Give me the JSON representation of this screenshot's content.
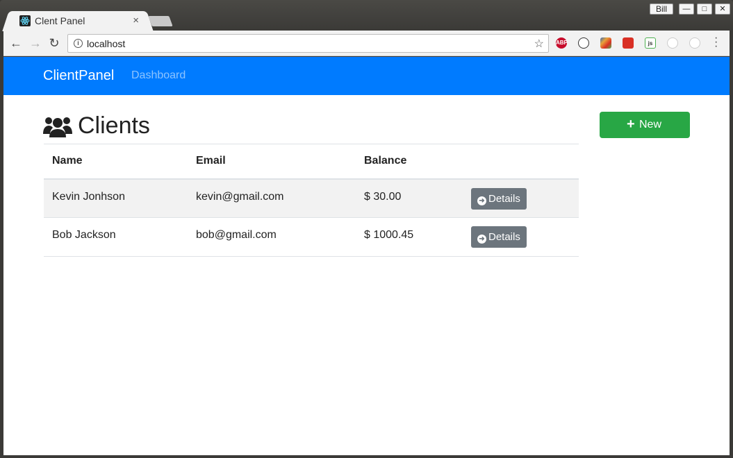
{
  "browser": {
    "tab_title": "Clent Panel",
    "tab_close": "×",
    "user_button": "Bill",
    "url": "localhost",
    "window_controls": [
      "minimize-icon",
      "maximize-icon",
      "close-icon"
    ],
    "extensions": [
      {
        "name": "adblock-plus-icon",
        "label": "ABP",
        "color": "#c70d2c"
      },
      {
        "name": "sync-extension-icon",
        "label": "",
        "color": "#333333"
      },
      {
        "name": "colorful-extension-icon",
        "label": "",
        "color": "#3b6bb5"
      },
      {
        "name": "red-extension-icon",
        "label": "",
        "color": "#d93025"
      },
      {
        "name": "js-extension-icon",
        "label": "js",
        "color": "#4caf50"
      },
      {
        "name": "clock-extension-icon",
        "label": "",
        "color": "#cccccc"
      },
      {
        "name": "feather-extension-icon",
        "label": "",
        "color": "#cccccc"
      }
    ]
  },
  "navbar": {
    "brand": "ClientPanel",
    "links": [
      "Dashboard"
    ],
    "color": "#007bff"
  },
  "main": {
    "title": "Clients",
    "new_button": "New",
    "new_button_color": "#28a745",
    "table": {
      "columns": [
        "Name",
        "Email",
        "Balance",
        ""
      ],
      "rows": [
        {
          "name": "Kevin Jonhson",
          "email": "kevin@gmail.com",
          "balance": "$ 30.00",
          "action": "Details"
        },
        {
          "name": "Bob Jackson",
          "email": "bob@gmail.com",
          "balance": "$ 1000.45",
          "action": "Details"
        }
      ]
    }
  }
}
